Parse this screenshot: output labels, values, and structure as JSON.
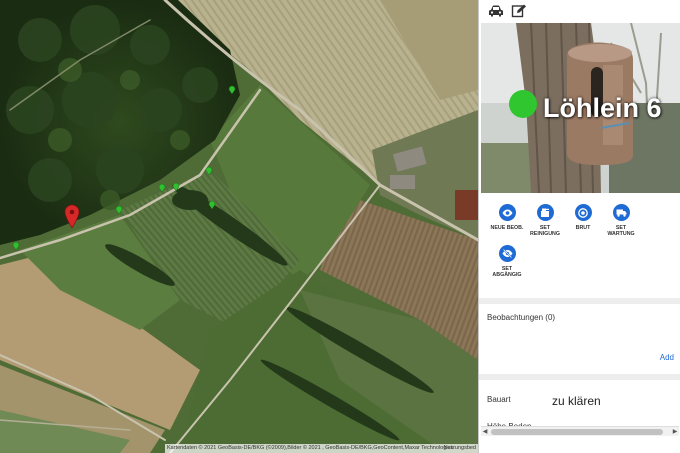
{
  "map": {
    "attribution": "Kartendaten © 2021 GeoBasis-DE/BKG (©2009),Bilder © 2021 , GeoBasis-DE/BKG,GeoContent,Maxar Technologies",
    "terms_link": "Nutzungsbed",
    "selected_marker_color": "#d62828",
    "marker_color": "#2fbf2f"
  },
  "toolbar": {
    "car_icon": "car-icon",
    "edit_icon": "edit-icon"
  },
  "detail": {
    "title": "Löhlein 6",
    "status_color": "#2fc62f",
    "actions": [
      {
        "label": "NEUE BEOB.",
        "icon": "eye-icon"
      },
      {
        "label": "SET\nREINIGUNG",
        "icon": "cleaning-icon"
      },
      {
        "label": "BRUT",
        "icon": "target-icon"
      },
      {
        "label": "SET\nWARTUNG",
        "icon": "truck-icon"
      },
      {
        "label": "SET\nABGÄNGIG",
        "icon": "eye-off-icon"
      }
    ],
    "observations_title": "Beobachtungen (0)",
    "add_label": "Add",
    "fields": [
      {
        "label": "Bauart",
        "value": "zu klären"
      },
      {
        "label": "Höhe Boden",
        "value": ""
      }
    ],
    "accent_color": "#1f6bd6"
  }
}
